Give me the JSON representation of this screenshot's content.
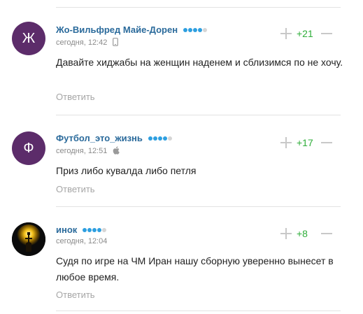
{
  "comments": [
    {
      "avatar_letter": "Ж",
      "author": "Жо-Вильфред Майе-Дорен",
      "rating_dots": 4,
      "timestamp": "сегодня, 12:42",
      "device_icon": "mobile-phone-icon",
      "text": "Давайте хиджабы на женщин наденем и сблизимся по не хочу.",
      "reply_label": "Ответить",
      "score": "+21"
    },
    {
      "avatar_letter": "Ф",
      "author": "Футбол_это_жизнь",
      "rating_dots": 4,
      "timestamp": "сегодня, 12:51",
      "device_icon": "apple-icon",
      "text": "Приз либо кувалда либо петля",
      "reply_label": "Ответить",
      "score": "+17"
    },
    {
      "avatar_letter": "",
      "author": "инок",
      "rating_dots": 4,
      "timestamp": "сегодня, 12:04",
      "device_icon": "",
      "text": "Судя по игре на ЧМ Иран нашу сборную уверенно вынесет в любое время.",
      "reply_label": "Ответить",
      "score": "+8"
    }
  ],
  "colors": {
    "author": "#2a6a9b",
    "score": "#2fae3a",
    "avatar_bg": "#5c2c6a",
    "dot_active": "#2e9fe0",
    "dot_inactive": "#d5d5d5"
  }
}
